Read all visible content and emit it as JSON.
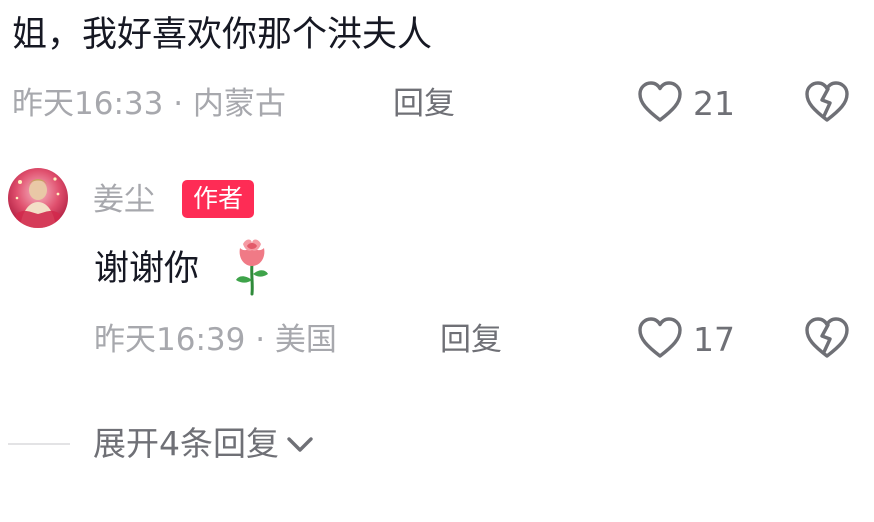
{
  "comment": {
    "text": "姐，我好喜欢你那个洪夫人",
    "meta": "昨天16:33 · 内蒙古",
    "reply_label": "回复",
    "like_count": "21"
  },
  "reply": {
    "author": "姜尘",
    "badge": "作者",
    "text": "谢谢你",
    "emoji_icon": "rose-icon",
    "meta": "昨天16:39 · 美国",
    "reply_label": "回复",
    "like_count": "17"
  },
  "expand_label": "展开4条回复",
  "colors": {
    "badge": "#fe2c55",
    "meta_text": "#a7a8ad",
    "secondary_text": "#6f7076",
    "primary_text": "#161823"
  }
}
